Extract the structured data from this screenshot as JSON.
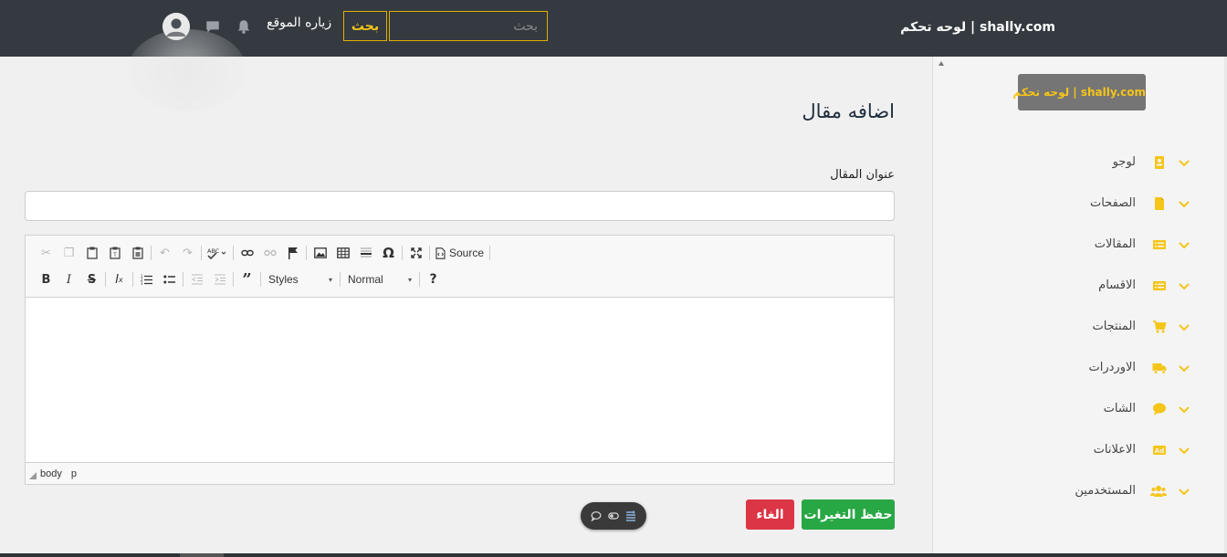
{
  "navbar": {
    "brand": "shally.com | لوحه تحكم",
    "search_placeholder": "بحث",
    "search_button": "بحث",
    "visit_site": "زياره الموقع"
  },
  "sidebar": {
    "brand": "shally.com | لوحه تحكم",
    "accent_color": "#f5c518",
    "items": [
      {
        "label": "لوجو",
        "icon": "id-card-icon"
      },
      {
        "label": "الصفحات",
        "icon": "file-icon"
      },
      {
        "label": "المقالات",
        "icon": "list-card-icon"
      },
      {
        "label": "الاقسام",
        "icon": "list-card-icon"
      },
      {
        "label": "المنتجات",
        "icon": "cart-icon"
      },
      {
        "label": "الاوردرات",
        "icon": "truck-icon"
      },
      {
        "label": "الشات",
        "icon": "comment-icon"
      },
      {
        "label": "الاعلانات",
        "icon": "ad-icon"
      },
      {
        "label": "المستخدمين",
        "icon": "users-icon"
      }
    ]
  },
  "main": {
    "page_title": "اضافه مقال",
    "title_field_label": "عنوان المقال",
    "title_field_value": "",
    "editor": {
      "source_label": "Source",
      "styles_label": "Styles",
      "format_label": "Normal",
      "path": [
        "body",
        "p"
      ]
    },
    "save_button": "حفظ التغيرات",
    "cancel_button": "الغاء"
  }
}
